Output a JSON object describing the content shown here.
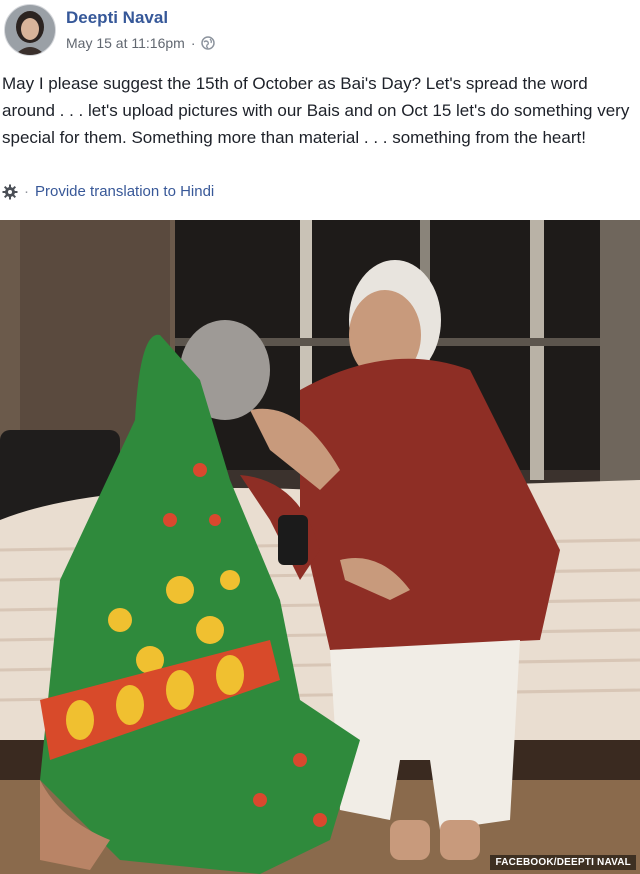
{
  "post": {
    "author": "Deepti Naval",
    "timestamp": "May 15 at 11:16pm",
    "separator": "·",
    "audience_icon": "globe-icon",
    "text": "May I please suggest the 15th of October as Bai's Day? Let's spread the word around . . . let's upload pictures with our Bais and on Oct 15 let's do something very special for them. Something more than material . . . something from the heart!",
    "translate_icon": "gear-icon",
    "translate_separator": "·",
    "translate_link": "Provide translation to Hindi"
  },
  "photo": {
    "credit": "FACEBOOK/DEEPTI NAVAL"
  },
  "colors": {
    "link": "#385898",
    "author": "#365899",
    "meta": "#616770",
    "text": "#1d2129"
  }
}
